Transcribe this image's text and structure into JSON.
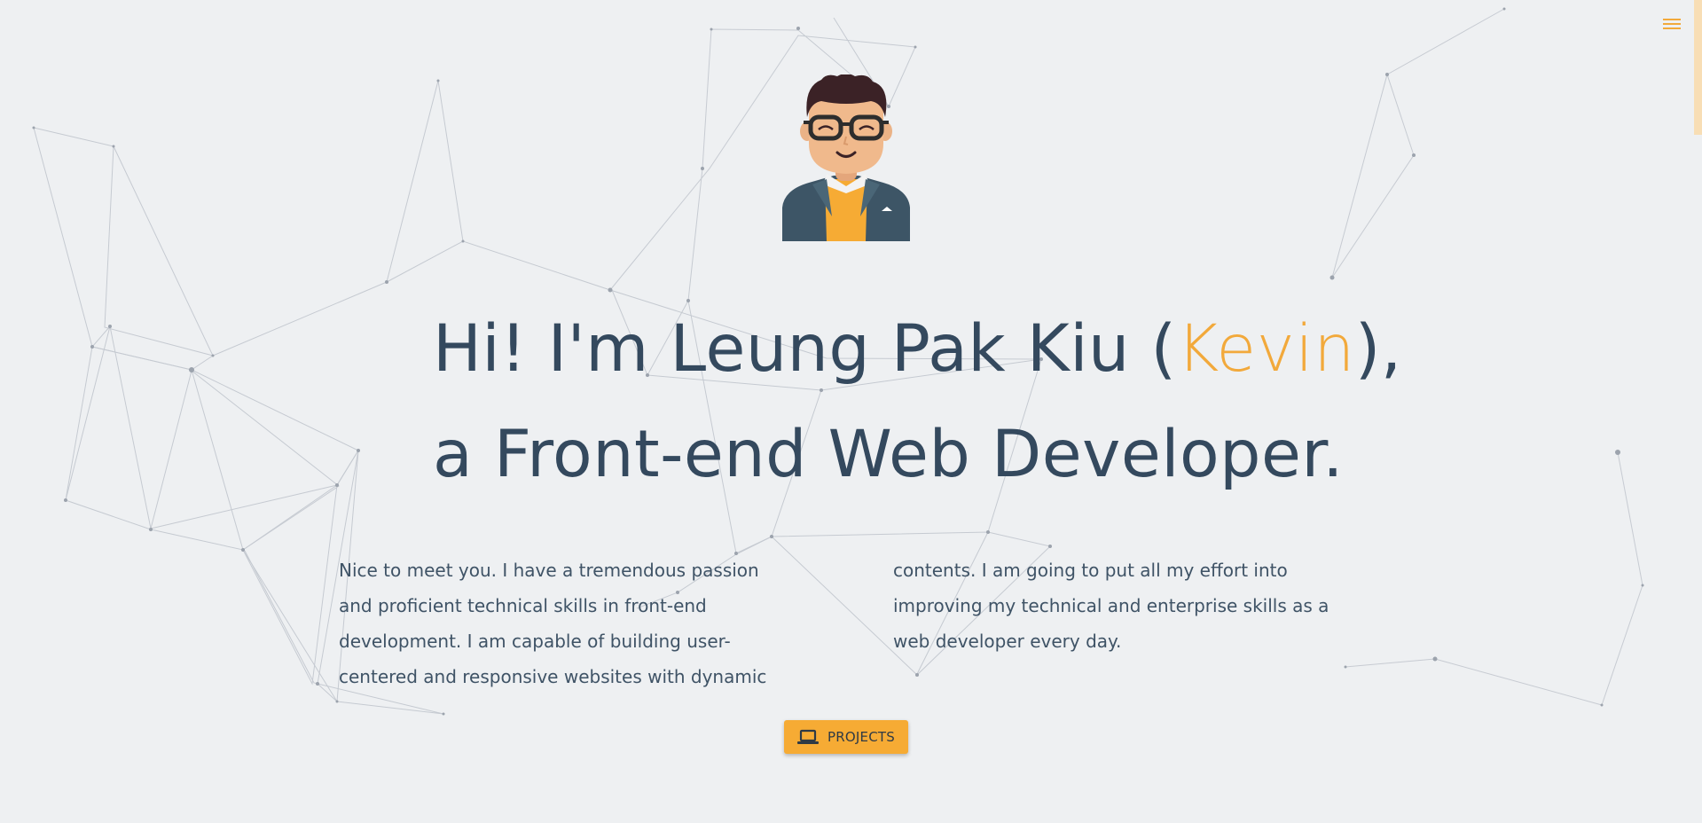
{
  "menu": {
    "icon": "hamburger-menu-icon"
  },
  "hero": {
    "greeting_prefix": "Hi! I'm Leung Pak Kiu (",
    "nickname": "Kevin",
    "greeting_suffix": "),",
    "tagline": "a Front-end Web Developer.",
    "intro": "Nice to meet you. I have a tremendous passion and proficient technical skills in front-end development. I am capable of building user-centered and responsive websites with dynamic contents. I am going to put all my effort into improving my technical and enterprise skills as a web developer every day."
  },
  "projects_button": {
    "label": "PROJECTS",
    "icon": "laptop-icon"
  },
  "colors": {
    "accent": "#f2a93b",
    "text": "#34495e",
    "background": "#eef0f2",
    "button": "#f6ab34"
  }
}
